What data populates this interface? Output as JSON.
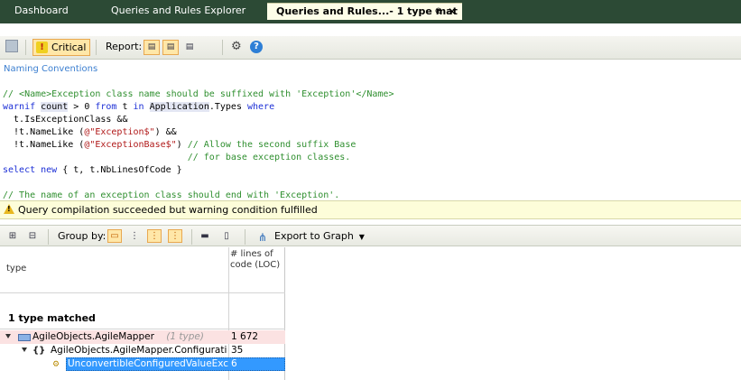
{
  "tabs": [
    {
      "label": "Dashboard"
    },
    {
      "label": "Queries and Rules Explorer"
    },
    {
      "label": "Queries and Rules...- 1 type mat",
      "pin": "⊕",
      "close": "✕"
    }
  ],
  "toolbar": {
    "severity_label": "Critical",
    "report_label": "Report:"
  },
  "query": {
    "category": "Naming Conventions",
    "code_lines": [
      "// <Name>Exception class name should be suffixed with 'Exception'</Name>",
      "warnif count > 0 from t in Application.Types where",
      "  t.IsExceptionClass &&",
      "  !t.NameLike (@\"Exception$\") &&",
      "  !t.NameLike (@\"ExceptionBase$\") // Allow the second suffix Base",
      "                                  // for base exception classes.",
      "select new { t, t.NbLinesOfCode }",
      "",
      "// The name of an exception class should end with 'Exception'."
    ]
  },
  "status": {
    "message": "Query compilation succeeded but warning condition fulfilled"
  },
  "results_toolbar": {
    "group_by_label": "Group by:",
    "export_label": "Export to Graph"
  },
  "results": {
    "columns": {
      "type": "type",
      "loc": "# lines of code (LOC)"
    },
    "matched_label": "1 type matched",
    "rows": [
      {
        "name": "AgileObjects.AgileMapper",
        "note": "(1 type)",
        "loc": "1 672"
      },
      {
        "name": "AgileObjects.AgileMapper.Configuration.(",
        "loc": "35"
      },
      {
        "name": "UnconvertibleConfiguredValueExcept",
        "loc": "6"
      }
    ]
  }
}
